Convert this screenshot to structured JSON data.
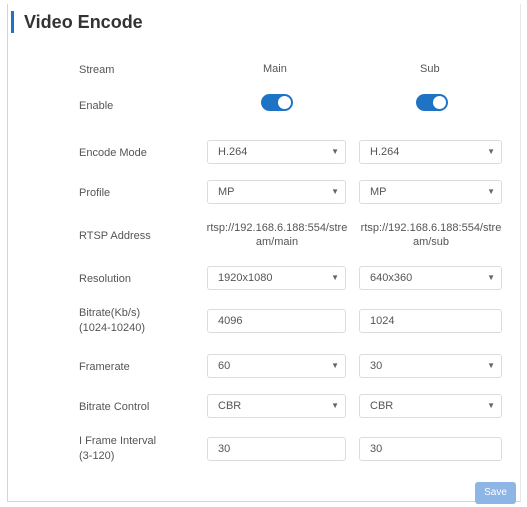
{
  "page": {
    "title": "Video Encode"
  },
  "columns": {
    "stream_label": "Stream",
    "main": "Main",
    "sub": "Sub"
  },
  "labels": {
    "enable": "Enable",
    "encode_mode": "Encode Mode",
    "profile": "Profile",
    "rtsp": "RTSP Address",
    "resolution": "Resolution",
    "bitrate_l1": "Bitrate(Kb/s)",
    "bitrate_l2": "(1024-10240)",
    "framerate": "Framerate",
    "bitrate_control": "Bitrate Control",
    "iframe_l1": "I Frame Interval",
    "iframe_l2": "(3-120)"
  },
  "main": {
    "enabled": true,
    "encode_mode": "H.264",
    "profile": "MP",
    "rtsp_l1": "rtsp://192.168.6.188:554/stre",
    "rtsp_l2": "am/main",
    "resolution": "1920x1080",
    "bitrate": "4096",
    "framerate": "60",
    "bitrate_control": "CBR",
    "iframe_interval": "30"
  },
  "sub": {
    "enabled": true,
    "encode_mode": "H.264",
    "profile": "MP",
    "rtsp_l1": "rtsp://192.168.6.188:554/stre",
    "rtsp_l2": "am/sub",
    "resolution": "640x360",
    "bitrate": "1024",
    "framerate": "30",
    "bitrate_control": "CBR",
    "iframe_interval": "30"
  },
  "save_label": "Save",
  "colors": {
    "accent": "#1f73c4",
    "save_button": "#8db5e6"
  },
  "icons": {
    "dropdown": "chevron-down-icon"
  }
}
